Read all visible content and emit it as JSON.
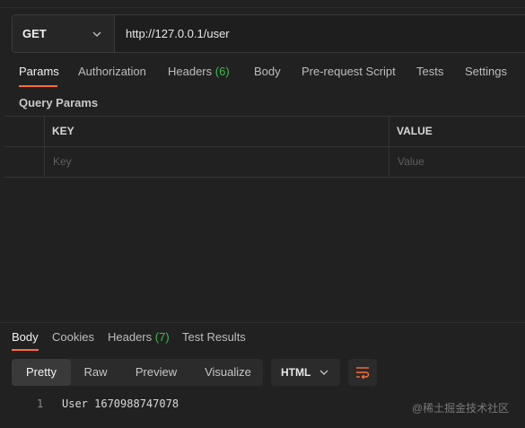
{
  "request": {
    "method": "GET",
    "url": "http://127.0.0.1/user"
  },
  "request_tabs": [
    {
      "label": "Params",
      "active": true
    },
    {
      "label": "Authorization"
    },
    {
      "label": "Headers",
      "count": "(6)"
    },
    {
      "label": "Body"
    },
    {
      "label": "Pre-request Script"
    },
    {
      "label": "Tests"
    },
    {
      "label": "Settings"
    }
  ],
  "query_params": {
    "title": "Query Params",
    "columns": {
      "key": "KEY",
      "value": "VALUE"
    },
    "placeholders": {
      "key": "Key",
      "value": "Value"
    }
  },
  "response_tabs": [
    {
      "label": "Body",
      "active": true
    },
    {
      "label": "Cookies"
    },
    {
      "label": "Headers",
      "count": "(7)"
    },
    {
      "label": "Test Results"
    }
  ],
  "view_modes": [
    {
      "label": "Pretty",
      "active": true
    },
    {
      "label": "Raw"
    },
    {
      "label": "Preview"
    },
    {
      "label": "Visualize"
    }
  ],
  "format": "HTML",
  "response_body": {
    "line_number": "1",
    "text": "User 1670988747078"
  },
  "watermark": "@稀土掘金技术社区",
  "colors": {
    "accent": "#ff6c37",
    "count": "#3fb950",
    "background": "#212121"
  },
  "icons": {
    "method_dropdown": "chevron-down-icon",
    "format_dropdown": "chevron-down-icon",
    "wrap": "wrap-lines-icon"
  }
}
